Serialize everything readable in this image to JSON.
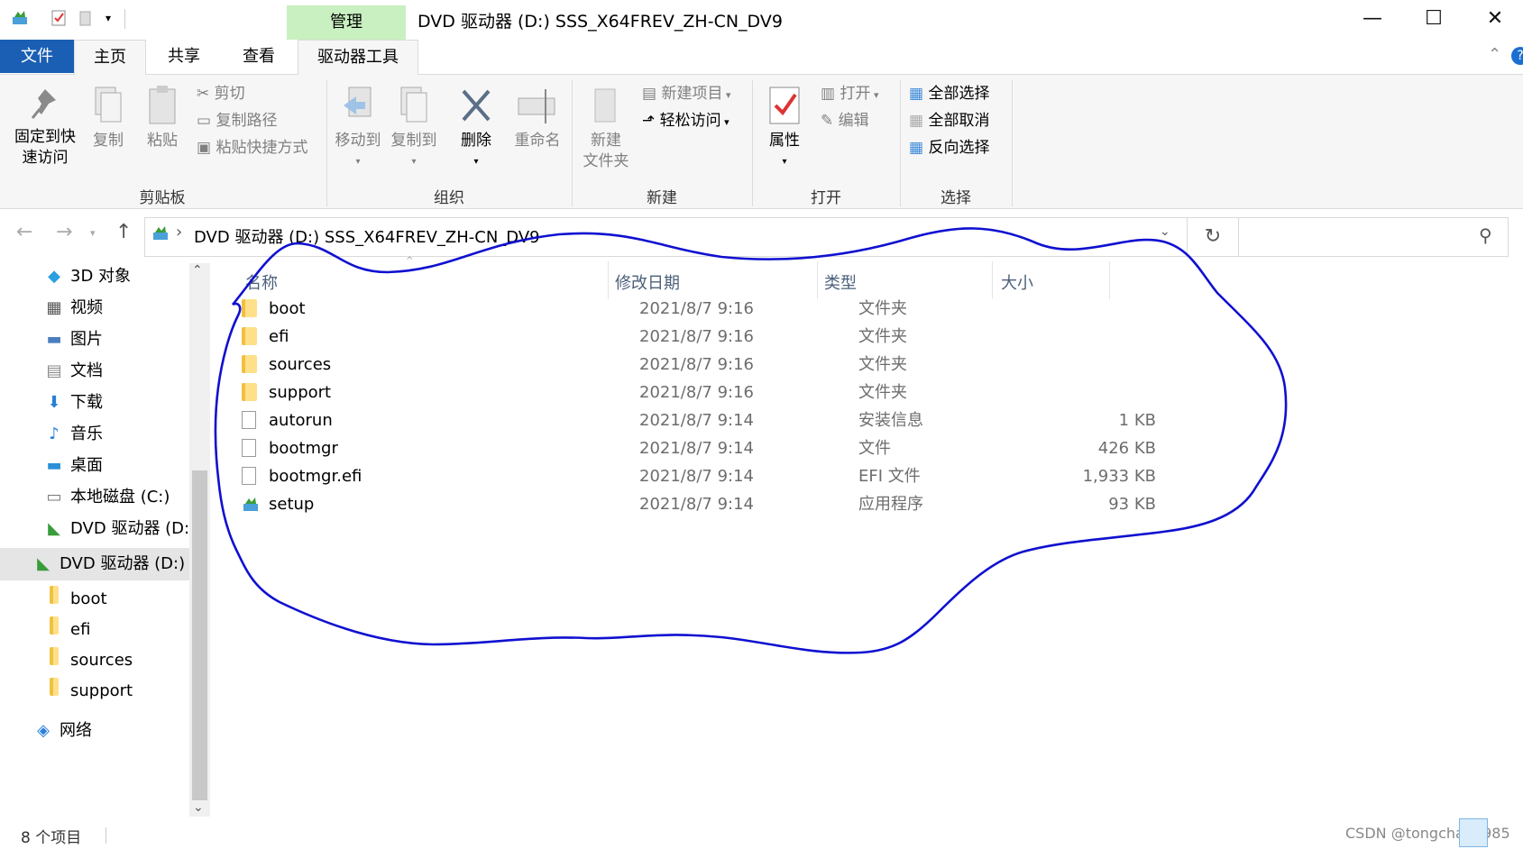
{
  "titlebar": {
    "context_tab": "管理",
    "title": "DVD 驱动器 (D:) SSS_X64FREV_ZH-CN_DV9",
    "minimize": "—",
    "maximize": "☐",
    "close": "✕"
  },
  "tabs": {
    "file": "文件",
    "home": "主页",
    "share": "共享",
    "view": "查看",
    "drive_tools": "驱动器工具"
  },
  "ribbon": {
    "clipboard": {
      "pin_line1": "固定到快",
      "pin_line2": "速访问",
      "copy": "复制",
      "paste": "粘贴",
      "cut": "剪切",
      "copy_path": "复制路径",
      "paste_shortcut": "粘贴快捷方式",
      "label": "剪贴板"
    },
    "organize": {
      "move_to": "移动到",
      "copy_to": "复制到",
      "delete": "删除",
      "rename": "重命名",
      "label": "组织"
    },
    "new": {
      "new_folder_line1": "新建",
      "new_folder_line2": "文件夹",
      "new_item": "新建项目",
      "easy_access": "轻松访问",
      "label": "新建"
    },
    "open": {
      "properties": "属性",
      "open": "打开",
      "edit": "编辑",
      "label": "打开"
    },
    "select": {
      "select_all": "全部选择",
      "select_none": "全部取消",
      "invert": "反向选择",
      "label": "选择"
    }
  },
  "address": {
    "path": "DVD 驱动器 (D:) SSS_X64FREV_ZH-CN_DV9",
    "separator": "›",
    "back": "←",
    "forward": "→",
    "up": "↑",
    "refresh": "↻",
    "search_icon": "⚲"
  },
  "nav_pane": {
    "items": [
      {
        "label": "3D 对象",
        "icon": "cube-icon"
      },
      {
        "label": "视频",
        "icon": "video-icon"
      },
      {
        "label": "图片",
        "icon": "pictures-icon"
      },
      {
        "label": "文档",
        "icon": "documents-icon"
      },
      {
        "label": "下载",
        "icon": "download-icon"
      },
      {
        "label": "音乐",
        "icon": "music-icon"
      },
      {
        "label": "桌面",
        "icon": "desktop-icon"
      },
      {
        "label": "本地磁盘 (C:)",
        "icon": "drive-icon"
      },
      {
        "label": "DVD 驱动器 (D:)",
        "icon": "dvd-icon"
      },
      {
        "label": "DVD 驱动器 (D:) S",
        "icon": "dvd-icon"
      },
      {
        "label": "boot",
        "icon": "folder-icon"
      },
      {
        "label": "efi",
        "icon": "folder-icon"
      },
      {
        "label": "sources",
        "icon": "folder-icon"
      },
      {
        "label": "support",
        "icon": "folder-icon"
      },
      {
        "label": "网络",
        "icon": "network-icon"
      }
    ]
  },
  "file_list": {
    "columns": {
      "name": "名称",
      "date": "修改日期",
      "type": "类型",
      "size": "大小"
    },
    "rows": [
      {
        "name": "boot",
        "date": "2021/8/7 9:16",
        "type": "文件夹",
        "size": "",
        "icon": "folder-icon"
      },
      {
        "name": "efi",
        "date": "2021/8/7 9:16",
        "type": "文件夹",
        "size": "",
        "icon": "folder-icon"
      },
      {
        "name": "sources",
        "date": "2021/8/7 9:16",
        "type": "文件夹",
        "size": "",
        "icon": "folder-icon"
      },
      {
        "name": "support",
        "date": "2021/8/7 9:16",
        "type": "文件夹",
        "size": "",
        "icon": "folder-icon"
      },
      {
        "name": "autorun",
        "date": "2021/8/7 9:14",
        "type": "安装信息",
        "size": "1 KB",
        "icon": "settings-file-icon"
      },
      {
        "name": "bootmgr",
        "date": "2021/8/7 9:14",
        "type": "文件",
        "size": "426 KB",
        "icon": "file-icon"
      },
      {
        "name": "bootmgr.efi",
        "date": "2021/8/7 9:14",
        "type": "EFI 文件",
        "size": "1,933 KB",
        "icon": "file-icon"
      },
      {
        "name": "setup",
        "date": "2021/8/7 9:14",
        "type": "应用程序",
        "size": "93 KB",
        "icon": "setup-app-icon"
      }
    ]
  },
  "status": {
    "count": "8 个项目",
    "watermark": "CSDN @tongchang985"
  },
  "colors": {
    "file_tab": "#1a5fb4",
    "context_tab": "#c9f0c0",
    "annotation": "#1010d0",
    "header_text": "#4c607a"
  }
}
